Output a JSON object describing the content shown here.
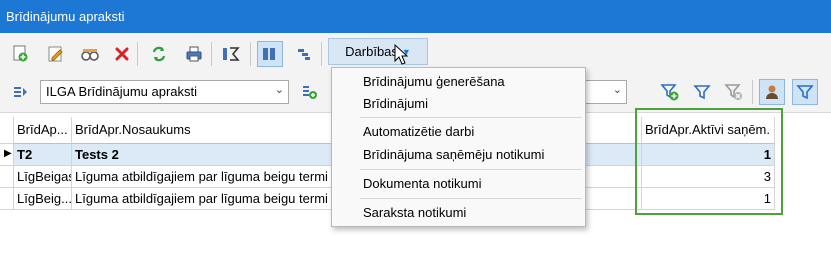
{
  "window": {
    "title": "Brīdinājumu apraksti"
  },
  "toolbar": {
    "darbibas_label": "Darbības",
    "icons": [
      "add-record-icon",
      "edit-icon",
      "view-icon",
      "delete-icon",
      "refresh-icon",
      "print-icon",
      "sum-icon",
      "columns-icon",
      "tree-icon"
    ]
  },
  "filter": {
    "query_selector_value": "ILGA Brīdinājumu apraksti",
    "icons": [
      "query-list-icon",
      "add-query-icon",
      "add-filter-icon",
      "filter-icon",
      "clear-filter-icon",
      "user-filter-icon",
      "quick-filter-icon"
    ]
  },
  "menu": {
    "items": [
      "Brīdinājumu ģenerēšana",
      "Brīdinājumi",
      "Automatizētie darbi",
      "Brīdinājuma saņēmēju notikumi",
      "Dokumenta notikumi",
      "Saraksta notikumi"
    ]
  },
  "grid": {
    "columns": [
      "BrīdAp...",
      "BrīdApr.Nosaukums",
      "BrīdApr.Aktīvi saņēm."
    ],
    "rows": [
      {
        "code": "T2",
        "name": "Tests 2",
        "count": "1",
        "selected": true
      },
      {
        "code": "LīgBeigas",
        "name": "Līguma atbildīgajiem par līguma beigu termi",
        "count": "3",
        "selected": false
      },
      {
        "code": "LīgBeig...",
        "name": "Līguma atbildīgajiem par līguma beigu termi",
        "count": "1",
        "selected": false
      }
    ]
  },
  "colors": {
    "titlebar": "#1c78d4",
    "highlight": "#4ea23a",
    "selected_row": "#dce9f7"
  }
}
